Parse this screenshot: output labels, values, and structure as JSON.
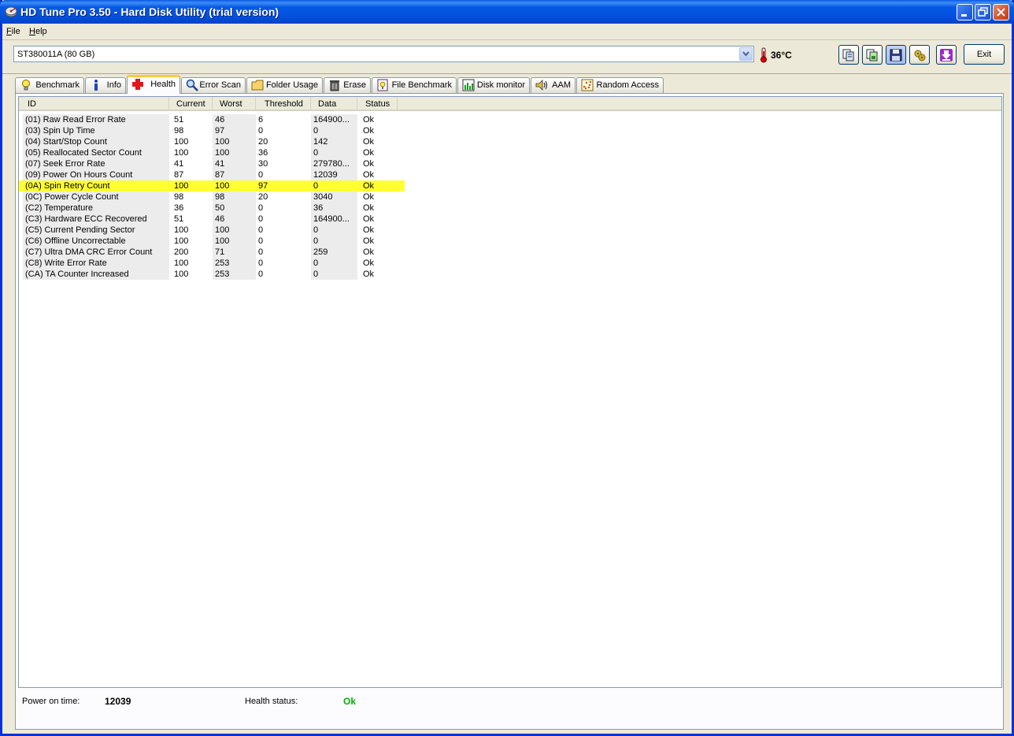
{
  "window": {
    "title": "HD Tune Pro 3.50 - Hard Disk Utility (trial version)"
  },
  "menu": {
    "file_accel": "F",
    "file_rest": "ile",
    "help_accel": "H",
    "help_rest": "elp"
  },
  "toolbar": {
    "drive": "ST380011A (80 GB)",
    "temperature": "36°C",
    "exit_label": "Exit"
  },
  "tabs": [
    {
      "label": "Benchmark",
      "icon": "lightbulb-icon"
    },
    {
      "label": "Info",
      "icon": "info-icon"
    },
    {
      "label": "Health",
      "icon": "health-cross-icon",
      "active": true
    },
    {
      "label": "Error Scan",
      "icon": "magnifier-icon"
    },
    {
      "label": "Folder Usage",
      "icon": "folder-icon"
    },
    {
      "label": "Erase",
      "icon": "trash-icon"
    },
    {
      "label": "File Benchmark",
      "icon": "file-benchmark-icon"
    },
    {
      "label": "Disk monitor",
      "icon": "disk-monitor-icon"
    },
    {
      "label": "AAM",
      "icon": "speaker-icon"
    },
    {
      "label": "Random Access",
      "icon": "random-access-icon"
    }
  ],
  "table": {
    "columns": [
      "ID",
      "Current",
      "Worst",
      "Threshold",
      "Data",
      "Status"
    ],
    "rows": [
      [
        "(01) Raw Read Error Rate",
        "51",
        "46",
        "6",
        "164900...",
        "Ok"
      ],
      [
        "(03) Spin Up Time",
        "98",
        "97",
        "0",
        "0",
        "Ok"
      ],
      [
        "(04) Start/Stop Count",
        "100",
        "100",
        "20",
        "142",
        "Ok"
      ],
      [
        "(05) Reallocated Sector Count",
        "100",
        "100",
        "36",
        "0",
        "Ok"
      ],
      [
        "(07) Seek Error Rate",
        "41",
        "41",
        "30",
        "279780...",
        "Ok"
      ],
      [
        "(09) Power On Hours Count",
        "87",
        "87",
        "0",
        "12039",
        "Ok"
      ],
      [
        "(0A) Spin Retry Count",
        "100",
        "100",
        "97",
        "0",
        "Ok"
      ],
      [
        "(0C) Power Cycle Count",
        "98",
        "98",
        "20",
        "3040",
        "Ok"
      ],
      [
        "(C2) Temperature",
        "36",
        "50",
        "0",
        "36",
        "Ok"
      ],
      [
        "(C3) Hardware ECC Recovered",
        "51",
        "46",
        "0",
        "164900...",
        "Ok"
      ],
      [
        "(C5) Current Pending Sector",
        "100",
        "100",
        "0",
        "0",
        "Ok"
      ],
      [
        "(C6) Offline Uncorrectable",
        "100",
        "100",
        "0",
        "0",
        "Ok"
      ],
      [
        "(C7) Ultra DMA CRC Error Count",
        "200",
        "71",
        "0",
        "259",
        "Ok"
      ],
      [
        "(C8) Write Error Rate",
        "100",
        "253",
        "0",
        "0",
        "Ok"
      ],
      [
        "(CA) TA Counter Increased",
        "100",
        "253",
        "0",
        "0",
        "Ok"
      ]
    ],
    "selected_row": 6
  },
  "status": {
    "power_on_label": "Power on time:",
    "power_on_value": "12039",
    "health_label": "Health status:",
    "health_value": "Ok"
  },
  "colors": {
    "highlight": "#ffff33",
    "health_ok": "#00b000",
    "accent": "#0450de"
  }
}
